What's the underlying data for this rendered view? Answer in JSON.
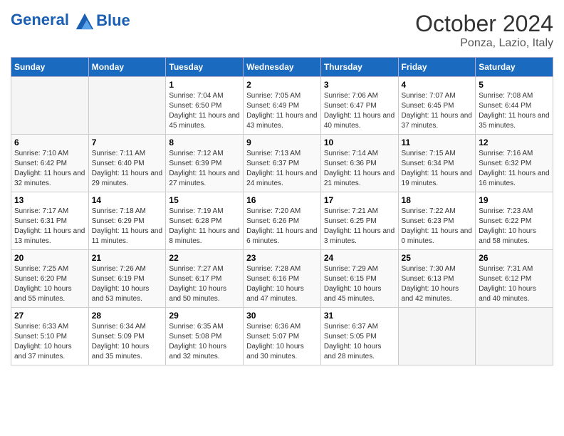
{
  "header": {
    "logo_line1": "General",
    "logo_line2": "Blue",
    "month": "October 2024",
    "location": "Ponza, Lazio, Italy"
  },
  "days_of_week": [
    "Sunday",
    "Monday",
    "Tuesday",
    "Wednesday",
    "Thursday",
    "Friday",
    "Saturday"
  ],
  "weeks": [
    [
      {
        "day": "",
        "info": ""
      },
      {
        "day": "",
        "info": ""
      },
      {
        "day": "1",
        "info": "Sunrise: 7:04 AM\nSunset: 6:50 PM\nDaylight: 11 hours and 45 minutes."
      },
      {
        "day": "2",
        "info": "Sunrise: 7:05 AM\nSunset: 6:49 PM\nDaylight: 11 hours and 43 minutes."
      },
      {
        "day": "3",
        "info": "Sunrise: 7:06 AM\nSunset: 6:47 PM\nDaylight: 11 hours and 40 minutes."
      },
      {
        "day": "4",
        "info": "Sunrise: 7:07 AM\nSunset: 6:45 PM\nDaylight: 11 hours and 37 minutes."
      },
      {
        "day": "5",
        "info": "Sunrise: 7:08 AM\nSunset: 6:44 PM\nDaylight: 11 hours and 35 minutes."
      }
    ],
    [
      {
        "day": "6",
        "info": "Sunrise: 7:10 AM\nSunset: 6:42 PM\nDaylight: 11 hours and 32 minutes."
      },
      {
        "day": "7",
        "info": "Sunrise: 7:11 AM\nSunset: 6:40 PM\nDaylight: 11 hours and 29 minutes."
      },
      {
        "day": "8",
        "info": "Sunrise: 7:12 AM\nSunset: 6:39 PM\nDaylight: 11 hours and 27 minutes."
      },
      {
        "day": "9",
        "info": "Sunrise: 7:13 AM\nSunset: 6:37 PM\nDaylight: 11 hours and 24 minutes."
      },
      {
        "day": "10",
        "info": "Sunrise: 7:14 AM\nSunset: 6:36 PM\nDaylight: 11 hours and 21 minutes."
      },
      {
        "day": "11",
        "info": "Sunrise: 7:15 AM\nSunset: 6:34 PM\nDaylight: 11 hours and 19 minutes."
      },
      {
        "day": "12",
        "info": "Sunrise: 7:16 AM\nSunset: 6:32 PM\nDaylight: 11 hours and 16 minutes."
      }
    ],
    [
      {
        "day": "13",
        "info": "Sunrise: 7:17 AM\nSunset: 6:31 PM\nDaylight: 11 hours and 13 minutes."
      },
      {
        "day": "14",
        "info": "Sunrise: 7:18 AM\nSunset: 6:29 PM\nDaylight: 11 hours and 11 minutes."
      },
      {
        "day": "15",
        "info": "Sunrise: 7:19 AM\nSunset: 6:28 PM\nDaylight: 11 hours and 8 minutes."
      },
      {
        "day": "16",
        "info": "Sunrise: 7:20 AM\nSunset: 6:26 PM\nDaylight: 11 hours and 6 minutes."
      },
      {
        "day": "17",
        "info": "Sunrise: 7:21 AM\nSunset: 6:25 PM\nDaylight: 11 hours and 3 minutes."
      },
      {
        "day": "18",
        "info": "Sunrise: 7:22 AM\nSunset: 6:23 PM\nDaylight: 11 hours and 0 minutes."
      },
      {
        "day": "19",
        "info": "Sunrise: 7:23 AM\nSunset: 6:22 PM\nDaylight: 10 hours and 58 minutes."
      }
    ],
    [
      {
        "day": "20",
        "info": "Sunrise: 7:25 AM\nSunset: 6:20 PM\nDaylight: 10 hours and 55 minutes."
      },
      {
        "day": "21",
        "info": "Sunrise: 7:26 AM\nSunset: 6:19 PM\nDaylight: 10 hours and 53 minutes."
      },
      {
        "day": "22",
        "info": "Sunrise: 7:27 AM\nSunset: 6:17 PM\nDaylight: 10 hours and 50 minutes."
      },
      {
        "day": "23",
        "info": "Sunrise: 7:28 AM\nSunset: 6:16 PM\nDaylight: 10 hours and 47 minutes."
      },
      {
        "day": "24",
        "info": "Sunrise: 7:29 AM\nSunset: 6:15 PM\nDaylight: 10 hours and 45 minutes."
      },
      {
        "day": "25",
        "info": "Sunrise: 7:30 AM\nSunset: 6:13 PM\nDaylight: 10 hours and 42 minutes."
      },
      {
        "day": "26",
        "info": "Sunrise: 7:31 AM\nSunset: 6:12 PM\nDaylight: 10 hours and 40 minutes."
      }
    ],
    [
      {
        "day": "27",
        "info": "Sunrise: 6:33 AM\nSunset: 5:10 PM\nDaylight: 10 hours and 37 minutes."
      },
      {
        "day": "28",
        "info": "Sunrise: 6:34 AM\nSunset: 5:09 PM\nDaylight: 10 hours and 35 minutes."
      },
      {
        "day": "29",
        "info": "Sunrise: 6:35 AM\nSunset: 5:08 PM\nDaylight: 10 hours and 32 minutes."
      },
      {
        "day": "30",
        "info": "Sunrise: 6:36 AM\nSunset: 5:07 PM\nDaylight: 10 hours and 30 minutes."
      },
      {
        "day": "31",
        "info": "Sunrise: 6:37 AM\nSunset: 5:05 PM\nDaylight: 10 hours and 28 minutes."
      },
      {
        "day": "",
        "info": ""
      },
      {
        "day": "",
        "info": ""
      }
    ]
  ]
}
